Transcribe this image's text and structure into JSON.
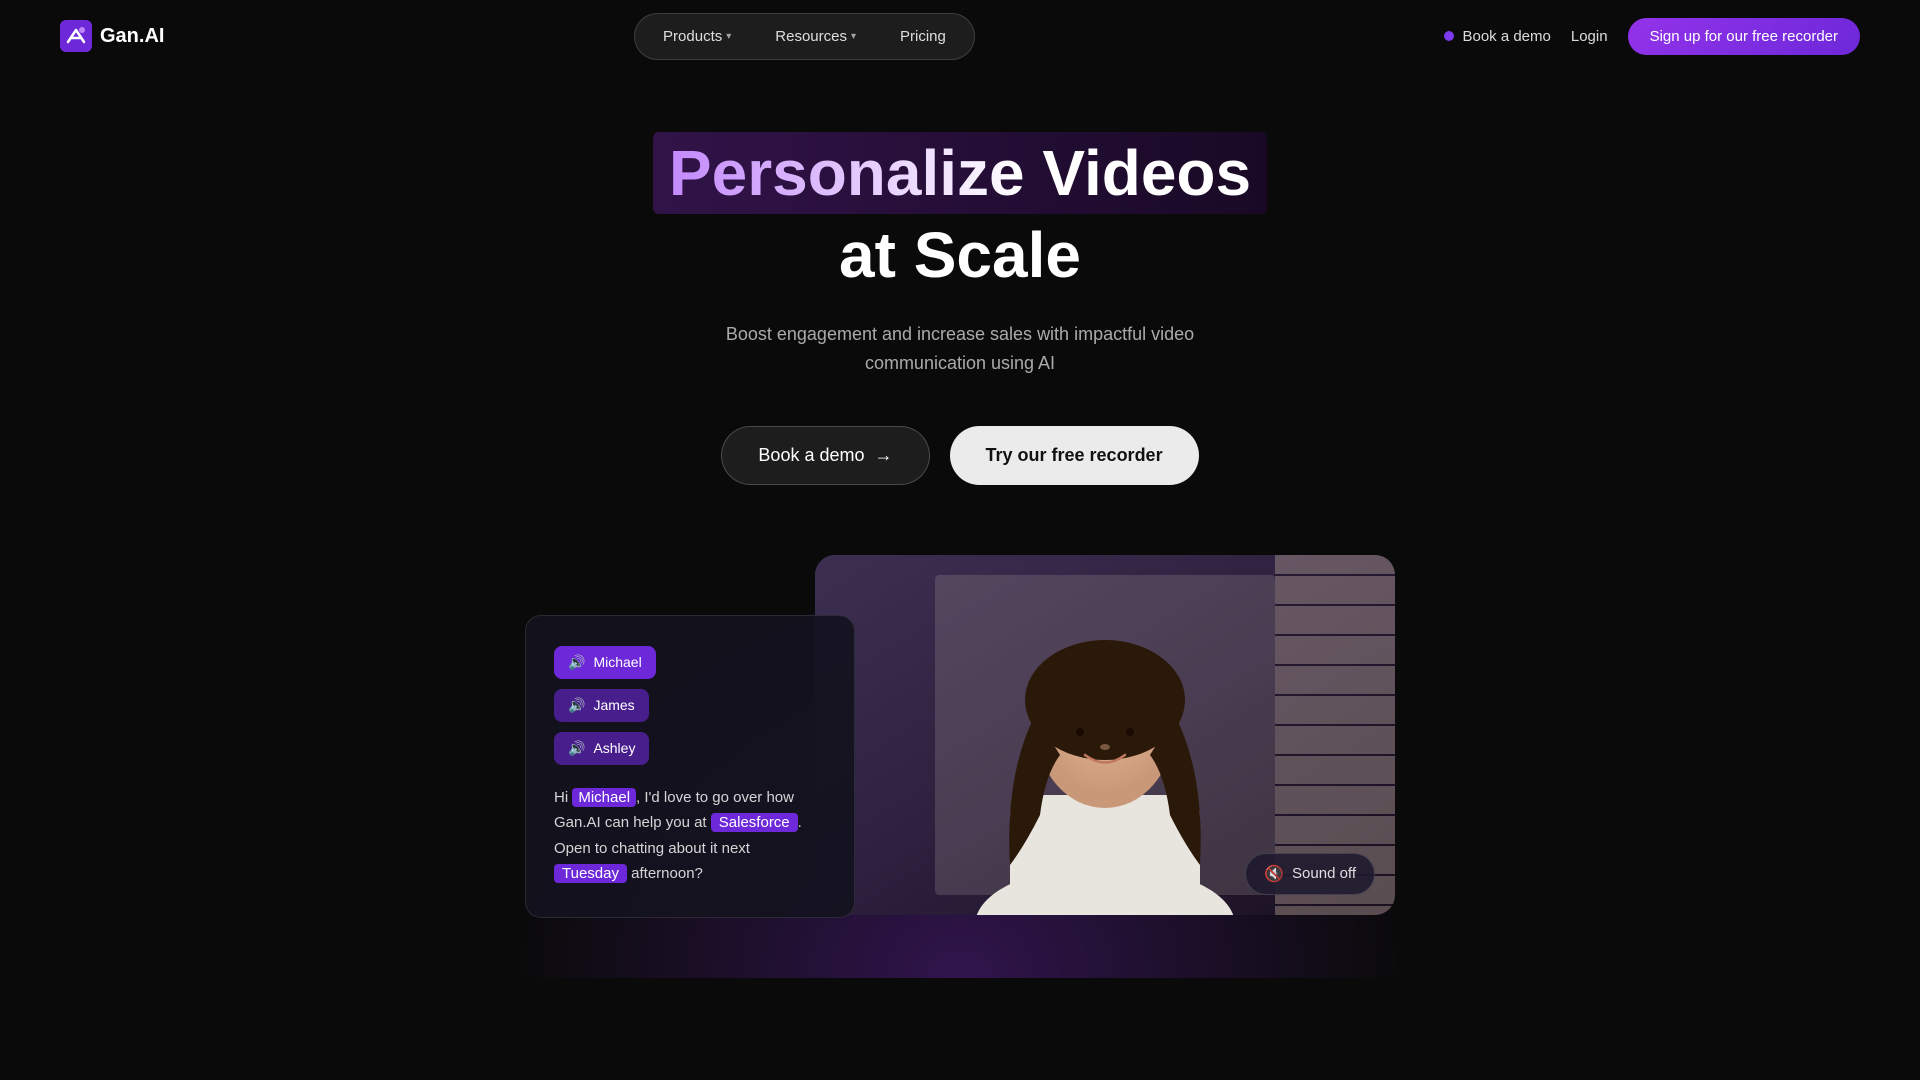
{
  "nav": {
    "logo_text": "Gan.AI",
    "items": [
      {
        "label": "Products",
        "has_dropdown": true
      },
      {
        "label": "Resources",
        "has_dropdown": true
      },
      {
        "label": "Pricing",
        "has_dropdown": false
      }
    ],
    "book_demo": "Book a demo",
    "login": "Login",
    "signup": "Sign up for our free recorder"
  },
  "hero": {
    "title_line1": "Personalize Videos",
    "title_line2": "at Scale",
    "subtitle_line1": "Boost engagement and increase sales with impactful video",
    "subtitle_line2": "communication using AI",
    "btn_demo": "Book a demo",
    "btn_recorder": "Try our free recorder"
  },
  "overlay_card": {
    "personas": [
      {
        "name": "Michael"
      },
      {
        "name": "James"
      },
      {
        "name": "Ashley"
      }
    ],
    "speech": {
      "prefix": "Hi ",
      "name": "Michael",
      "middle": ", I'd love to go over how Gan.AI can help you at ",
      "company": "Salesforce",
      "day_prefix": ". Open to chatting about it next ",
      "day": "Tuesday",
      "suffix": " afternoon?"
    }
  },
  "video": {
    "sound_off_label": "Sound off"
  },
  "colors": {
    "accent": "#6d28d9",
    "bg": "#0a0a0a"
  }
}
